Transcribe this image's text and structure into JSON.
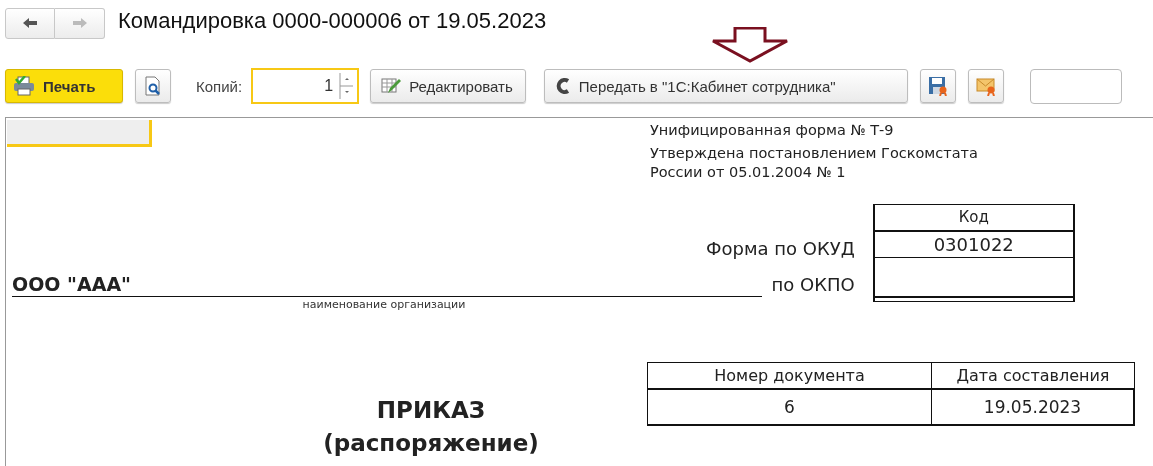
{
  "nav": {
    "back": {
      "disabled": false
    },
    "forward": {
      "disabled": true
    }
  },
  "title": "Командировка 0000-000006 от 19.05.2023",
  "toolbar": {
    "print": "Печать",
    "copies": {
      "label": "Копий:",
      "value": "1"
    },
    "edit": "Редактировать",
    "send": "Передать в \"1С:Кабинет сотрудника\""
  },
  "document": {
    "form_lines": [
      "Унифицированная форма № Т-9",
      "Утверждена постановлением Госкомстата",
      "России от 05.01.2004 № 1"
    ],
    "code_header": "Код",
    "code_rows": [
      {
        "label": "Форма по ОКУД",
        "value": "0301022"
      },
      {
        "label": "по ОКПО",
        "value": ""
      }
    ],
    "organization": "ООО \"ААА\"",
    "organization_caption": "наименование организации",
    "number_table": {
      "columns": [
        "Номер документа",
        "Дата составления"
      ],
      "values": [
        "6",
        "19.05.2023"
      ]
    },
    "heading": [
      "ПРИКАЗ",
      "(распоряжение)"
    ]
  }
}
